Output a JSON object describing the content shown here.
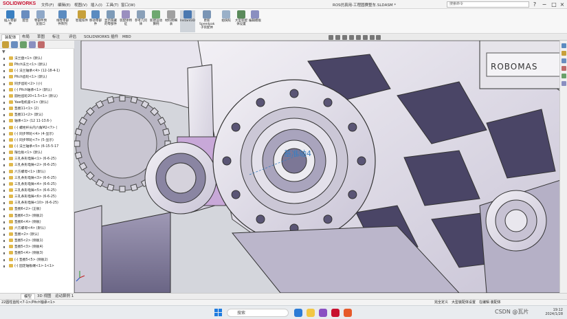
{
  "app": {
    "logo": "SOLIDWORKS",
    "title": "ROS仿真用-工程圆赛整车.SLDASM *",
    "search_placeholder": "搜索命令"
  },
  "menu": [
    "文件(F)",
    "编辑(E)",
    "视图(V)",
    "插入(I)",
    "工具(T)",
    "窗口(W)"
  ],
  "window_controls": [
    "?",
    "−",
    "□",
    "×"
  ],
  "ribbon": [
    {
      "label": "插入零部件",
      "color": "#3a7fc1"
    },
    {
      "label": "配合",
      "color": "#6a8dbf"
    },
    {
      "label": "零部件预览窗口",
      "color": "#8fa8c8"
    },
    {
      "label": "线性零部件阵列",
      "color": "#5b8bc0"
    },
    {
      "label": "智能扣件",
      "color": "#c7a03a"
    },
    {
      "label": "移动零部件",
      "color": "#5b8bc0"
    },
    {
      "label": "显示隐藏的零部件",
      "color": "#7e9bb8"
    },
    {
      "label": "装配体特征",
      "color": "#9a8fbf"
    },
    {
      "label": "参考几何体",
      "color": "#8aa0b8"
    },
    {
      "label": "新建运动算例",
      "color": "#6fa870"
    },
    {
      "label": "材料明细表",
      "color": "#a0a0a0"
    },
    {
      "label": "Instant3D",
      "color": "#4a78b0"
    },
    {
      "label": "更新Speedpak子装配体",
      "color": "#7a95b5"
    },
    {
      "label": "拍快照",
      "color": "#9ab0c8"
    },
    {
      "label": "大型装配体设置",
      "color": "#5a8a5a"
    },
    {
      "label": "编辑模板",
      "color": "#8a8fc0"
    }
  ],
  "tabs": [
    "装配体",
    "布局",
    "草图",
    "标注",
    "评估",
    "SOLIDWORKS 插件",
    "MBD"
  ],
  "tree": [
    "法兰盘<1> (默认)",
    "Pitch法兰<1> (默认)",
    "(-) 法兰轴承<4> (12-18-4-1)",
    "Pitch齿轮<1> (默认)",
    "同步齿轮<2> (小)",
    "(-) Pitch轴承<1> (默认)",
    "圆柱齿轮20<1.5<1> (默认)",
    "Yaw电机座<1> (默认)",
    "垫圈11<1> (2)",
    "垫圈11<2> (默认)",
    "轴承<1> (12 11-13.6-)",
    "(-) 螺栓杆头内六角M2<7> (",
    "(-) 同步带轮<4> (4-显示)",
    "(-) 同步带轮<7> (5-显示)",
    "(-) 法兰轴承<5> (6-15-5-17",
    "限位板<1> (默认)",
    "三孔条形电铸<1> (6-6-25)",
    "三孔条形电铸<2> (6-6-25)",
    "六方螺母<1> (默认)",
    "三孔条形电铸<3> (6-6-25)",
    "三孔条形电铸<4> (6-6-25)",
    "三孔条形电铸<5> (6-6-25)",
    "三孔条形电铸<6> (6-6-25)",
    "三孔条形电铸<10> (6-6-25)",
    "垫圈6<2> (正板)",
    "垫圈6<3> (侧板2)",
    "垫圈6<4> (侧板)",
    "六方螺母<4> (默认)",
    "垫圈<2> (默认)",
    "垫圈5<2> (侧板1)",
    "垫圈5<3> (侧板4)",
    "垫圈5<4> (侧板3)",
    "(-) 垫圈5<5> (侧板2)",
    "(-) 固定轴板端<1>-1<1>"
  ],
  "viewport": {
    "annotation": "基准轴4",
    "brand_text": "ROBOMAS"
  },
  "bottom_tabs": [
    "模型",
    "3D 视图",
    "运动算例 1"
  ],
  "status": {
    "left": "22圆柱齿轮<7-1>/Pitch轴承<1>",
    "mid1": "完全定义",
    "mid2": "大型装配体设置",
    "mid3": "在编辑 装配体"
  },
  "taskbar": {
    "search_label": "搜索",
    "time": "19:12",
    "date": "2024/1/28"
  },
  "watermark": "CSDN @瓦片",
  "colors": {
    "accent": "#c8102e",
    "selection": "#cfd4da",
    "part_light": "#e9e6ee",
    "part_shadow": "#8f8aa6",
    "purple": "#b7a8d0"
  }
}
